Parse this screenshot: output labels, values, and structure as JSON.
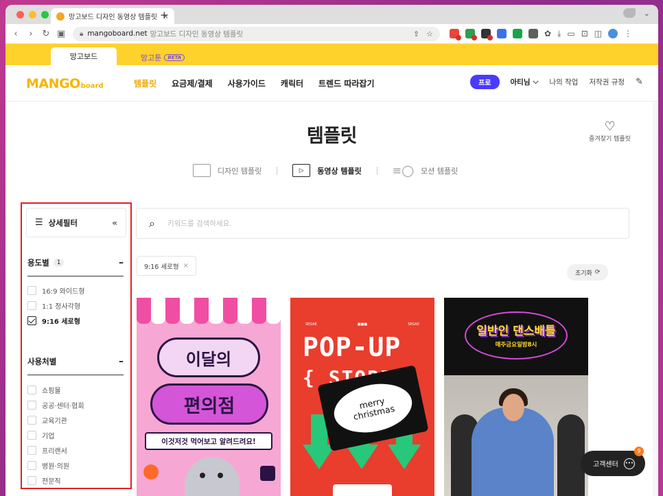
{
  "browser": {
    "tab_title": "망고보드 디자인 동영상 템플릿",
    "tab_close": "×",
    "new_tab": "+",
    "url_host": "mangoboard.net",
    "url_page": "망고보드 디자인 동영상 템플릿"
  },
  "site_tabs": {
    "active": "망고보드",
    "second": "망고툰",
    "second_badge": "BETA"
  },
  "header": {
    "logo_main": "MANGO",
    "logo_sub": "board",
    "nav": [
      "템플릿",
      "요금제/결제",
      "사용가이드",
      "캐릭터",
      "트렌드 따라잡기"
    ],
    "pro_badge": "프로",
    "user_name": "아티님",
    "user_caret": "⌵",
    "my_work": "나의 작업",
    "copyright": "저작권 규정"
  },
  "page": {
    "title": "템플릿",
    "favorites_label": "즐겨찾기 템플릿"
  },
  "categories": [
    {
      "label": "디자인 템플릿",
      "active": false
    },
    {
      "label": "동영상 템플릿",
      "active": true
    },
    {
      "label": "모션 템플릿",
      "active": false
    }
  ],
  "sidebar": {
    "filter_title": "상세필터",
    "collapse_glyph": "«",
    "usage": {
      "title": "용도별",
      "count": "1",
      "collapse": "–",
      "options": [
        {
          "label": "16:9 와이드형",
          "checked": false
        },
        {
          "label": "1:1 정사각형",
          "checked": false
        },
        {
          "label": "9:16 세로형",
          "checked": true
        }
      ]
    },
    "place": {
      "title": "사용처별",
      "collapse": "–",
      "options": [
        {
          "label": "쇼핑몰",
          "checked": false
        },
        {
          "label": "공공·센터·협회",
          "checked": false
        },
        {
          "label": "교육기관",
          "checked": false
        },
        {
          "label": "기업",
          "checked": false
        },
        {
          "label": "프리랜서",
          "checked": false
        },
        {
          "label": "병원·의원",
          "checked": false
        },
        {
          "label": "전문직",
          "checked": false
        }
      ]
    }
  },
  "search": {
    "placeholder": "키워드를 검색하세요.",
    "value": ""
  },
  "active_filter_chip": "9:16 세로형",
  "chip_remove": "×",
  "reset_label": "초기화",
  "reset_icon": "⟳",
  "cards": {
    "card1": {
      "line1": "이달의",
      "line2": "편의점",
      "subtitle": "이것저것 먹어보고 알려드려요!"
    },
    "card2": {
      "brand_left": "SEGAE",
      "brand_mid": "■■■",
      "brand_right": "SEGAE",
      "title1": "POP-UP",
      "title2": "{ STORE }",
      "sticker1": "merry",
      "sticker2": "christmas"
    },
    "card3": {
      "title": "일반인 댄스배틀",
      "date": "매주금요일밤8시"
    }
  },
  "help_center": {
    "label": "고객센터",
    "badge": "9"
  },
  "colors": {
    "brand_yellow": "#ffd12b",
    "accent_orange": "#f0a800",
    "pro_purple": "#4a3aff",
    "highlight_red": "#e02020"
  }
}
